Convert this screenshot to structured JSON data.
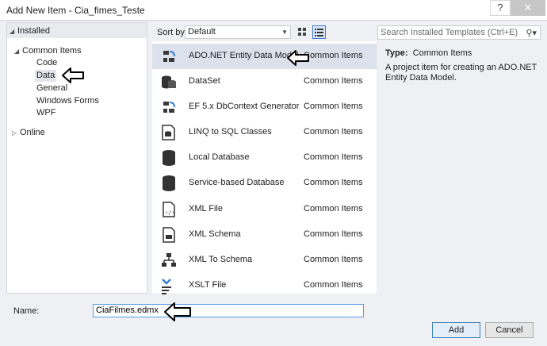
{
  "window": {
    "title": "Add New Item - Cia_fimes_Teste",
    "help_label": "?",
    "close_label": "✕"
  },
  "tree": {
    "installed": "Installed",
    "common_items": "Common Items",
    "children": [
      "Code",
      "Data",
      "General",
      "Windows Forms",
      "WPF"
    ],
    "online": "Online"
  },
  "toolbar": {
    "sort_label": "Sort by:",
    "sort_value": "Default",
    "search_placeholder": "Search Installed Templates (Ctrl+E)"
  },
  "items": [
    {
      "name": "ADO.NET Entity Data Model",
      "category": "Common Items",
      "icon": "entity-model-icon"
    },
    {
      "name": "DataSet",
      "category": "Common Items",
      "icon": "dataset-icon"
    },
    {
      "name": "EF 5.x DbContext Generator",
      "category": "Common Items",
      "icon": "dbcontext-generator-icon"
    },
    {
      "name": "LINQ to SQL Classes",
      "category": "Common Items",
      "icon": "linq-to-sql-icon"
    },
    {
      "name": "Local Database",
      "category": "Common Items",
      "icon": "database-icon"
    },
    {
      "name": "Service-based Database",
      "category": "Common Items",
      "icon": "database-icon"
    },
    {
      "name": "XML File",
      "category": "Common Items",
      "icon": "xml-file-icon"
    },
    {
      "name": "XML Schema",
      "category": "Common Items",
      "icon": "xml-schema-icon"
    },
    {
      "name": "XML To Schema",
      "category": "Common Items",
      "icon": "xml-to-schema-icon"
    },
    {
      "name": "XSLT File",
      "category": "Common Items",
      "icon": "xslt-file-icon"
    }
  ],
  "details": {
    "type_label": "Type:",
    "type_value": "Common Items",
    "description": "A project item for creating an ADO.NET Entity Data Model."
  },
  "footer": {
    "name_label": "Name:",
    "name_value": "CiaFilmes.edmx",
    "add_label": "Add",
    "cancel_label": "Cancel"
  }
}
